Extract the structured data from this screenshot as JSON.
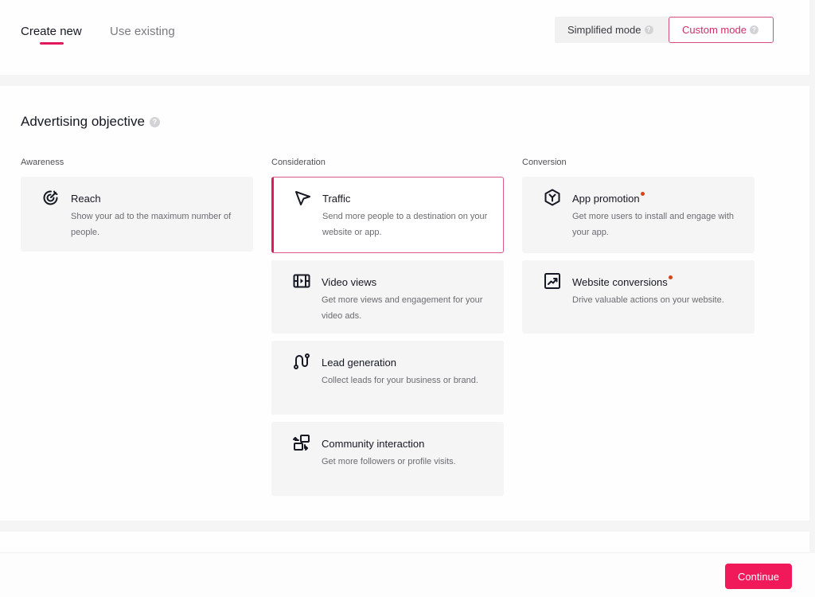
{
  "colors": {
    "brand": "#fe2c55",
    "accent": "#e2185c",
    "custom_mode_text": "#c8306a",
    "new_badge": "#d4451b"
  },
  "header": {
    "tabs": [
      {
        "label": "Create new",
        "active": true
      },
      {
        "label": "Use existing",
        "active": false
      }
    ],
    "mode_switch": {
      "simplified": {
        "label": "Simplified mode",
        "help_icon": "question-circle-icon",
        "selected": false
      },
      "custom": {
        "label": "Custom mode",
        "help_icon": "question-circle-icon",
        "selected": true
      }
    }
  },
  "objective": {
    "title": "Advertising objective",
    "help_icon": "question-circle-icon",
    "columns": [
      {
        "label": "Awareness",
        "cards": [
          {
            "title": "Reach",
            "description": "Show your ad to the maximum number of people.",
            "icon": "target-icon",
            "selected": false,
            "new": false
          }
        ]
      },
      {
        "label": "Consideration",
        "cards": [
          {
            "title": "Traffic",
            "description": "Send more people to a destination on your website or app.",
            "icon": "cursor-arrow-icon",
            "selected": true,
            "new": false
          },
          {
            "title": "Video views",
            "description": "Get more views and engagement for your video ads.",
            "icon": "video-film-icon",
            "selected": false,
            "new": false
          },
          {
            "title": "Lead generation",
            "description": "Collect leads for your business or brand.",
            "icon": "lead-path-icon",
            "selected": false,
            "new": false
          },
          {
            "title": "Community interaction",
            "description": "Get more followers or profile visits.",
            "icon": "community-swap-icon",
            "selected": false,
            "new": false
          }
        ]
      },
      {
        "label": "Conversion",
        "cards": [
          {
            "title": "App promotion",
            "description": "Get more users to install and engage with your app.",
            "icon": "app-cube-icon",
            "selected": false,
            "new": true
          },
          {
            "title": "Website conversions",
            "description": "Drive valuable actions on your website.",
            "icon": "trend-chart-icon",
            "selected": false,
            "new": true
          }
        ]
      }
    ]
  },
  "footer": {
    "continue_label": "Continue"
  }
}
